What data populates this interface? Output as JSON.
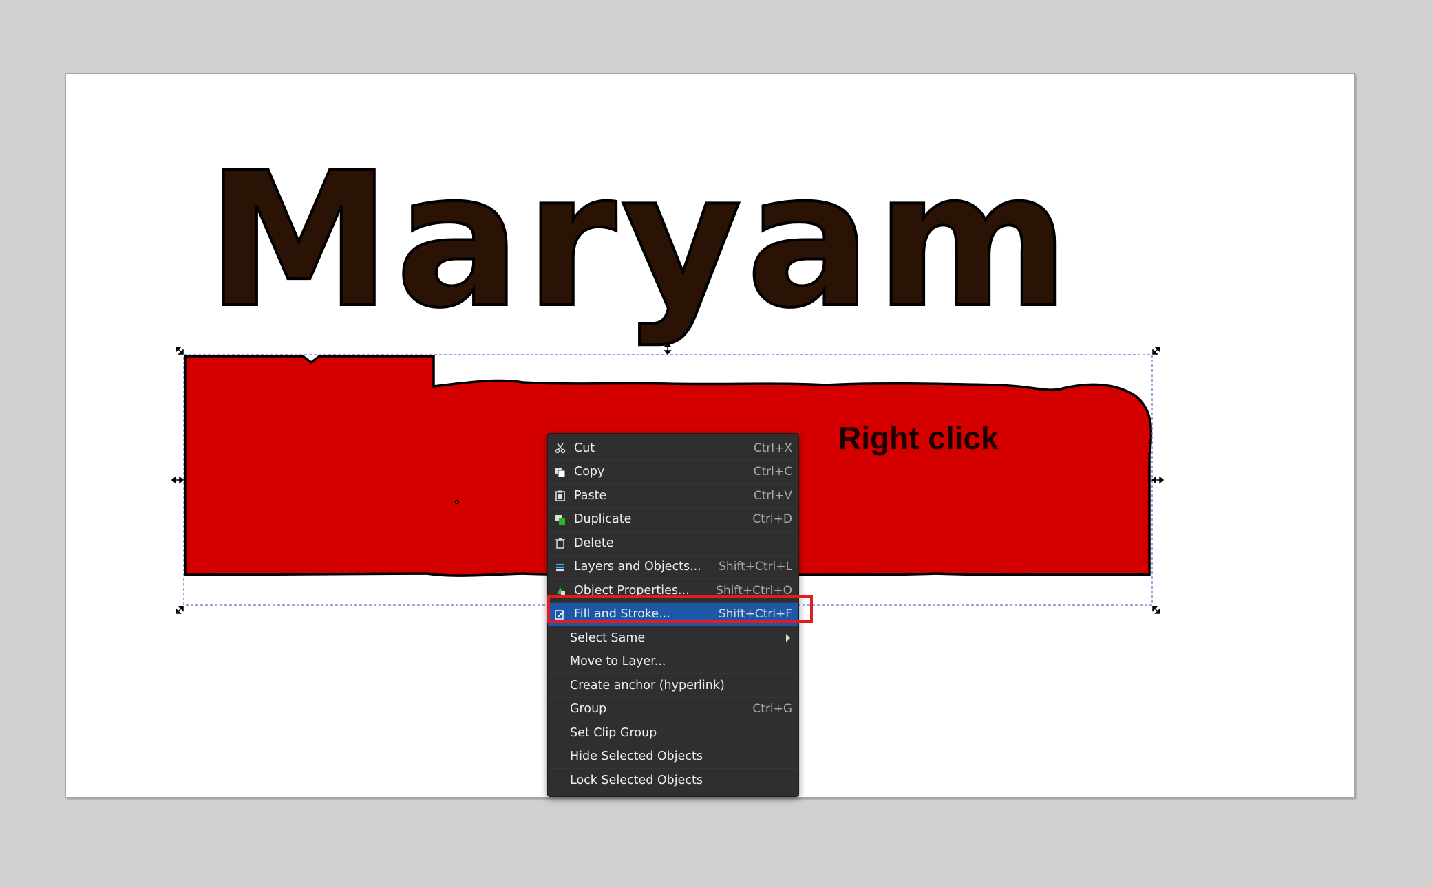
{
  "canvas": {
    "title_text": "Maryam",
    "annotation": "Right click"
  },
  "colors": {
    "title_fill": "#2a1304",
    "shape_fill": "#d40000",
    "menu_bg": "#2f2f2f",
    "menu_active": "#1c57a8",
    "highlight_box": "#e31b23"
  },
  "context_menu": {
    "items": [
      {
        "label": "Cut",
        "shortcut": "Ctrl+X",
        "icon": "scissors-icon"
      },
      {
        "label": "Copy",
        "shortcut": "Ctrl+C",
        "icon": "copy-icon"
      },
      {
        "label": "Paste",
        "shortcut": "Ctrl+V",
        "icon": "paste-icon"
      },
      {
        "label": "Duplicate",
        "shortcut": "Ctrl+D",
        "icon": "duplicate-icon"
      },
      {
        "label": "Delete",
        "shortcut": "",
        "icon": "trash-icon"
      },
      {
        "label": "Layers and Objects...",
        "shortcut": "Shift+Ctrl+L",
        "icon": "layers-icon"
      },
      {
        "label": "Object Properties...",
        "shortcut": "Shift+Ctrl+O",
        "icon": "object-properties-icon"
      },
      {
        "label": "Fill and Stroke...",
        "shortcut": "Shift+Ctrl+F",
        "icon": "fill-stroke-icon",
        "active": true
      },
      {
        "label": "Select Same",
        "shortcut": "",
        "icon": "",
        "submenu": true
      },
      {
        "label": "Move to Layer...",
        "shortcut": "",
        "icon": ""
      },
      {
        "label": "Create anchor (hyperlink)",
        "shortcut": "",
        "icon": ""
      },
      {
        "label": "Group",
        "shortcut": "Ctrl+G",
        "icon": ""
      },
      {
        "label": "Set Clip Group",
        "shortcut": "",
        "icon": ""
      },
      {
        "label": "Hide Selected Objects",
        "shortcut": "",
        "icon": ""
      },
      {
        "label": "Lock Selected Objects",
        "shortcut": "",
        "icon": ""
      }
    ]
  }
}
